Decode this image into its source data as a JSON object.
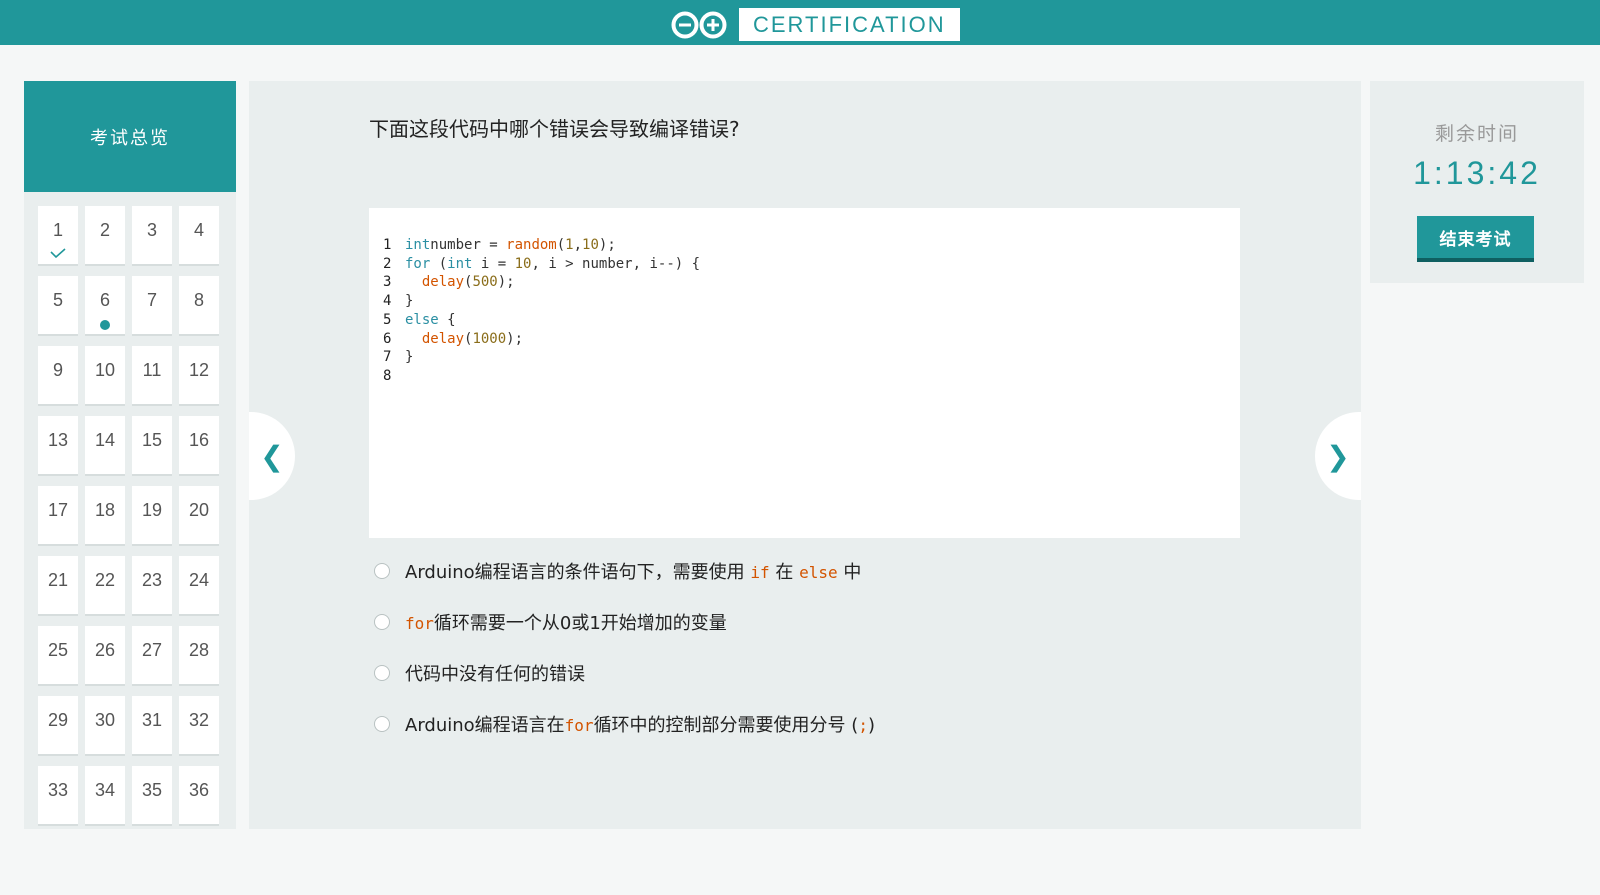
{
  "header": {
    "title": "CERTIFICATION",
    "logo_icon": "arduino-infinity-logo",
    "bg_color": "#20979a"
  },
  "sidebar": {
    "title": "考试总览",
    "questions": [
      "1",
      "2",
      "3",
      "4",
      "5",
      "6",
      "7",
      "8",
      "9",
      "10",
      "11",
      "12",
      "13",
      "14",
      "15",
      "16",
      "17",
      "18",
      "19",
      "20",
      "21",
      "22",
      "23",
      "24",
      "25",
      "26",
      "27",
      "28",
      "29",
      "30",
      "31",
      "32",
      "33",
      "34",
      "35",
      "36"
    ],
    "answered": [
      "1"
    ],
    "current": "6",
    "answered_icon": "check-icon"
  },
  "question": {
    "prompt": "下面这段代码中哪个错误会导致编译错误?",
    "code_lines": [
      [
        "1",
        [
          [
            "kw",
            "int"
          ],
          [
            "",
            "number = "
          ],
          [
            "fn",
            "random"
          ],
          [
            "",
            "("
          ],
          [
            "nm",
            "1"
          ],
          [
            "",
            ","
          ],
          [
            "nm",
            "10"
          ],
          [
            "",
            ");"
          ]
        ]
      ],
      [
        "2",
        [
          [
            "kw",
            "for"
          ],
          [
            "",
            " ("
          ],
          [
            "kw",
            "int"
          ],
          [
            "",
            " i = "
          ],
          [
            "nm",
            "10"
          ],
          [
            "",
            ", i > number, i--) {"
          ]
        ]
      ],
      [
        "3",
        [
          [
            "",
            "  "
          ],
          [
            "fn",
            "delay"
          ],
          [
            "",
            "("
          ],
          [
            "nm",
            "500"
          ],
          [
            "",
            ");"
          ]
        ]
      ],
      [
        "4",
        [
          [
            "",
            "}"
          ]
        ]
      ],
      [
        "5",
        [
          [
            "kw",
            "else"
          ],
          [
            "",
            " {"
          ]
        ]
      ],
      [
        "6",
        [
          [
            "",
            "  "
          ],
          [
            "fn",
            "delay"
          ],
          [
            "",
            "("
          ],
          [
            "nm",
            "1000"
          ],
          [
            "",
            ");"
          ]
        ]
      ],
      [
        "7",
        [
          [
            "",
            "}"
          ]
        ]
      ],
      [
        "8",
        []
      ]
    ],
    "options": [
      [
        [
          "t",
          "Arduino编程语言的条件语句下，需要使用 "
        ],
        [
          "c",
          "if"
        ],
        [
          "t",
          " 在 "
        ],
        [
          "c",
          "else"
        ],
        [
          "t",
          " 中"
        ]
      ],
      [
        [
          "c",
          "for"
        ],
        [
          "t",
          "循环需要一个从0或1开始增加的变量"
        ]
      ],
      [
        [
          "t",
          "代码中没有任何的错误"
        ]
      ],
      [
        [
          "t",
          "Arduino编程语言在"
        ],
        [
          "c",
          "for"
        ],
        [
          "t",
          "循环中的控制部分需要使用分号 ("
        ],
        [
          "c",
          ";"
        ],
        [
          "t",
          ")"
        ]
      ]
    ]
  },
  "nav": {
    "prev": "❮",
    "next": "❯",
    "prev_icon": "chevron-left-icon",
    "next_icon": "chevron-right-icon"
  },
  "timer": {
    "label": "剩余时间",
    "value": "1:13:42",
    "end_button": "结束考试"
  },
  "colors": {
    "accent": "#20979a",
    "code_keyword": "#2b8fa3",
    "code_function": "#d35400",
    "code_number": "#8a6d1a"
  }
}
